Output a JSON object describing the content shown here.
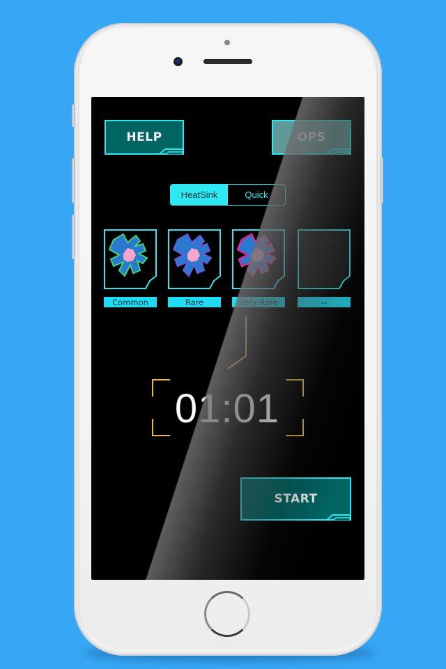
{
  "app": {
    "header": {
      "help_label": "HELP",
      "ops_label": "OPS"
    },
    "mode_toggle": {
      "options": [
        {
          "label": "HeatSink",
          "selected": true
        },
        {
          "label": "Quick",
          "selected": false
        }
      ]
    },
    "slots": [
      {
        "label": "Common",
        "icon": "heatsink-common-icon",
        "accent": "#3fd27a"
      },
      {
        "label": "Rare",
        "icon": "heatsink-rare-icon",
        "accent": "#6a5ad6"
      },
      {
        "label": "Very Rare",
        "icon": "heatsink-very-rare-icon",
        "accent": "#e0289a"
      },
      {
        "label": "--",
        "icon": "empty-slot",
        "accent": null
      }
    ],
    "timer": {
      "value": "01:01"
    },
    "start_label": "START"
  },
  "colors": {
    "background": "#37a7f5",
    "accent_cyan": "#33e6f0",
    "button_teal": "#006462",
    "button_ops": "#5f9a99",
    "label_cyan": "#1fdcf5",
    "timer_bracket": "#e8b552",
    "heatsink_blue": "#2a78d0",
    "heatsink_core": "#f6a6cc"
  }
}
